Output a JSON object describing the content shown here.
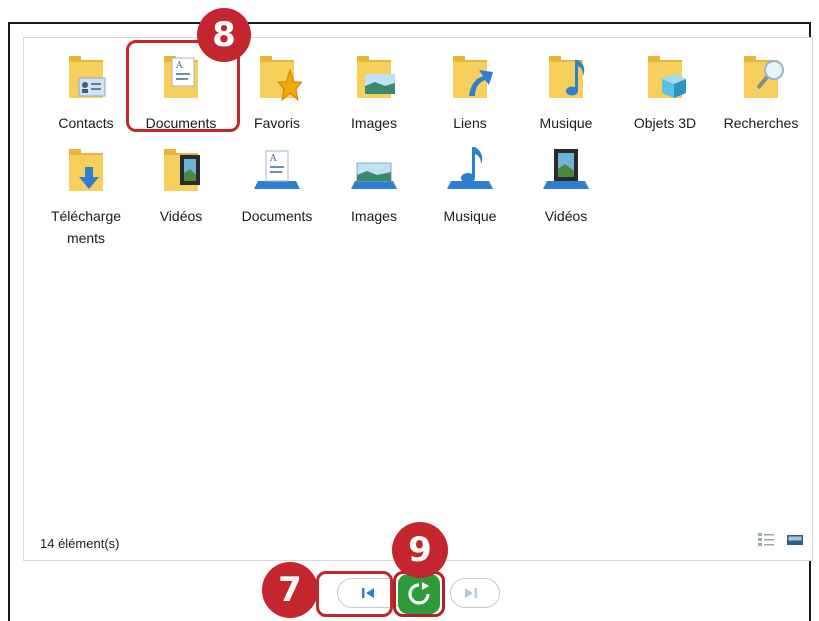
{
  "items": [
    {
      "label": "Contacts",
      "icon": "contacts-folder-icon"
    },
    {
      "label": "Documents",
      "icon": "documents-folder-icon"
    },
    {
      "label": "Favoris",
      "icon": "favorites-folder-icon"
    },
    {
      "label": "Images",
      "icon": "pictures-folder-icon"
    },
    {
      "label": "Liens",
      "icon": "links-folder-icon"
    },
    {
      "label": "Musique",
      "icon": "music-folder-icon"
    },
    {
      "label": "Objets 3D",
      "icon": "3d-objects-folder-icon"
    },
    {
      "label": "Recherches",
      "icon": "searches-folder-icon"
    },
    {
      "label": "Téléchargements",
      "label_display": "Télécharge ments",
      "icon": "downloads-folder-icon"
    },
    {
      "label": "Vidéos",
      "icon": "videos-folder-icon"
    },
    {
      "label": "Documents",
      "icon": "documents-library-icon"
    },
    {
      "label": "Images",
      "icon": "pictures-library-icon"
    },
    {
      "label": "Musique",
      "icon": "music-library-icon"
    },
    {
      "label": "Vidéos",
      "icon": "videos-library-icon"
    }
  ],
  "status": {
    "count_text": "14 élément(s)"
  },
  "view_buttons": [
    "details-view-icon",
    "large-icons-view-icon"
  ],
  "nav": {
    "first_icon": "skip-to-start-icon",
    "refresh_icon": "refresh-icon",
    "last_icon": "skip-to-end-icon"
  },
  "annotations": {
    "badge_8": "8",
    "badge_9": "9",
    "badge_7": "7"
  },
  "colors": {
    "accent_red": "#c4262e",
    "folder_yellow": "#f7cf5c",
    "refresh_green": "#2e9b3a",
    "link_blue": "#2f7fd0"
  }
}
